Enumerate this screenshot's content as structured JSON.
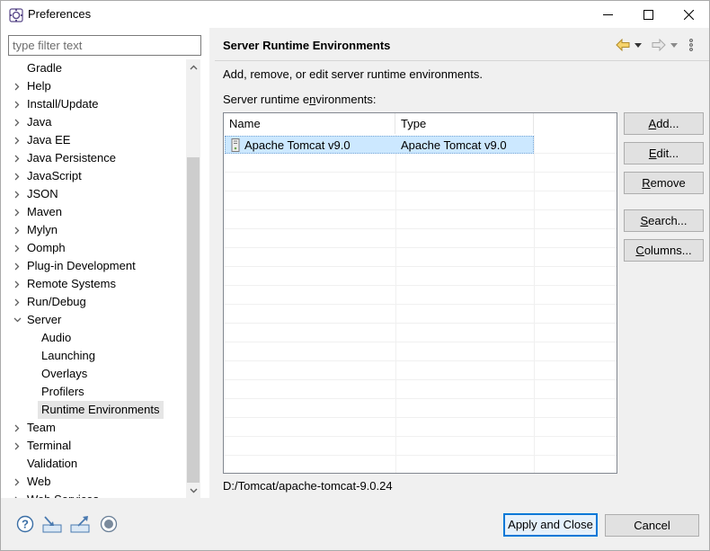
{
  "window": {
    "title": "Preferences"
  },
  "filter": {
    "placeholder": "type filter text",
    "value": ""
  },
  "tree": {
    "items": [
      {
        "label": "Gradle",
        "level": 0,
        "arrow": "none"
      },
      {
        "label": "Help",
        "level": 0,
        "arrow": "collapsed"
      },
      {
        "label": "Install/Update",
        "level": 0,
        "arrow": "collapsed"
      },
      {
        "label": "Java",
        "level": 0,
        "arrow": "collapsed"
      },
      {
        "label": "Java EE",
        "level": 0,
        "arrow": "collapsed"
      },
      {
        "label": "Java Persistence",
        "level": 0,
        "arrow": "collapsed"
      },
      {
        "label": "JavaScript",
        "level": 0,
        "arrow": "collapsed"
      },
      {
        "label": "JSON",
        "level": 0,
        "arrow": "collapsed"
      },
      {
        "label": "Maven",
        "level": 0,
        "arrow": "collapsed"
      },
      {
        "label": "Mylyn",
        "level": 0,
        "arrow": "collapsed"
      },
      {
        "label": "Oomph",
        "level": 0,
        "arrow": "collapsed"
      },
      {
        "label": "Plug-in Development",
        "level": 0,
        "arrow": "collapsed"
      },
      {
        "label": "Remote Systems",
        "level": 0,
        "arrow": "collapsed"
      },
      {
        "label": "Run/Debug",
        "level": 0,
        "arrow": "collapsed"
      },
      {
        "label": "Server",
        "level": 0,
        "arrow": "expanded"
      },
      {
        "label": "Audio",
        "level": 1,
        "arrow": "none"
      },
      {
        "label": "Launching",
        "level": 1,
        "arrow": "none"
      },
      {
        "label": "Overlays",
        "level": 1,
        "arrow": "none"
      },
      {
        "label": "Profilers",
        "level": 1,
        "arrow": "none"
      },
      {
        "label": "Runtime Environments",
        "level": 1,
        "arrow": "none",
        "selected": true
      },
      {
        "label": "Team",
        "level": 0,
        "arrow": "collapsed"
      },
      {
        "label": "Terminal",
        "level": 0,
        "arrow": "collapsed"
      },
      {
        "label": "Validation",
        "level": 0,
        "arrow": "none"
      },
      {
        "label": "Web",
        "level": 0,
        "arrow": "collapsed"
      },
      {
        "label": "Web Services",
        "level": 0,
        "arrow": "collapsed"
      }
    ]
  },
  "page": {
    "title": "Server Runtime Environments",
    "description": "Add, remove, or edit server runtime environments.",
    "list_label_pre": "Server runtime e",
    "list_label_mnemonic": "n",
    "list_label_post": "vironments:"
  },
  "table": {
    "columns": [
      "Name",
      "Type"
    ],
    "rows": [
      {
        "name": "Apache Tomcat v9.0",
        "type": "Apache Tomcat v9.0",
        "selected": true
      }
    ]
  },
  "buttons": {
    "add": {
      "mnemonic": "A",
      "rest": "dd..."
    },
    "edit": {
      "mnemonic": "E",
      "rest": "dit..."
    },
    "remove": {
      "mnemonic": "R",
      "rest": "emove"
    },
    "search": {
      "mnemonic": "S",
      "rest": "earch..."
    },
    "columns": {
      "mnemonic": "C",
      "rest": "olumns..."
    }
  },
  "selected_path": "D:/Tomcat/apache-tomcat-9.0.24",
  "footer": {
    "apply_close": "Apply and Close",
    "cancel": "Cancel"
  },
  "colors": {
    "selection": "#cce8ff",
    "default_button_border": "#0078d7",
    "tree_selection": "#e5e5e5"
  }
}
